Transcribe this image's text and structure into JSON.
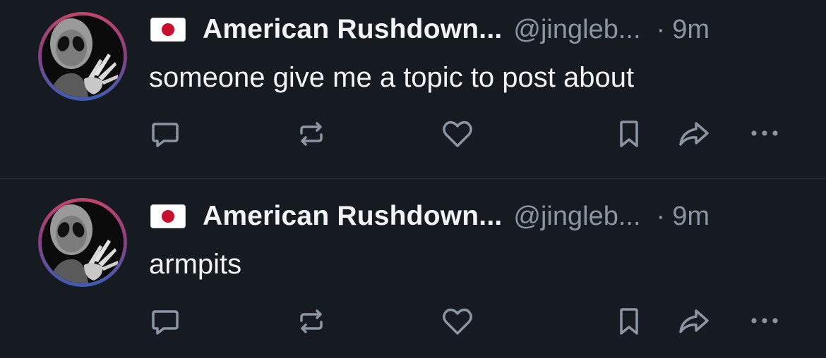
{
  "posts": [
    {
      "author": {
        "flag_icon": "japan-flag-icon",
        "display_name": "American Rushdown...",
        "handle": "@jingleb...",
        "separator": "·",
        "time": "9m"
      },
      "text": "someone give me a topic to post about",
      "actions": [
        "reply-icon",
        "repost-icon",
        "like-icon",
        "bookmark-icon",
        "share-icon",
        "more-icon"
      ]
    },
    {
      "author": {
        "flag_icon": "japan-flag-icon",
        "display_name": "American Rushdown...",
        "handle": "@jingleb...",
        "separator": "·",
        "time": "9m"
      },
      "text": "armpits",
      "actions": [
        "reply-icon",
        "repost-icon",
        "like-icon",
        "bookmark-icon",
        "share-icon",
        "more-icon"
      ]
    }
  ],
  "colors": {
    "background": "#161b22",
    "text_primary": "#f1f3f5",
    "text_secondary": "#8c96a3",
    "icon": "#8c96a3",
    "avatar_ring_top": "#c2456b",
    "avatar_ring_bottom": "#3d5fb0",
    "flag_red": "#c8102e",
    "divider": "#2a313b"
  }
}
